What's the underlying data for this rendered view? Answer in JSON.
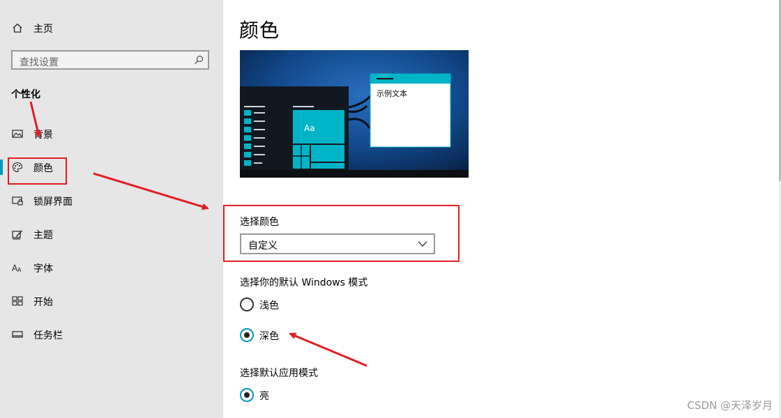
{
  "sidebar": {
    "home_label": "主页",
    "search_placeholder": "查找设置",
    "group_title": "个性化",
    "items": [
      {
        "label": "背景",
        "icon": "picture-icon"
      },
      {
        "label": "颜色",
        "icon": "palette-icon",
        "selected": true
      },
      {
        "label": "锁屏界面",
        "icon": "lock-screen-icon"
      },
      {
        "label": "主题",
        "icon": "theme-icon"
      },
      {
        "label": "字体",
        "icon": "font-icon"
      },
      {
        "label": "开始",
        "icon": "start-icon"
      },
      {
        "label": "任务栏",
        "icon": "taskbar-icon"
      }
    ],
    "accent_color": "#0099bc"
  },
  "main": {
    "title": "颜色",
    "preview": {
      "tile_text": "Aa",
      "window_text": "示例文本",
      "accent_color": "#00b4c8"
    },
    "choose_color": {
      "label": "选择颜色",
      "value": "自定义"
    },
    "windows_mode": {
      "label": "选择你的默认 Windows 模式",
      "options": [
        {
          "label": "浅色",
          "selected": false
        },
        {
          "label": "深色",
          "selected": true
        }
      ]
    },
    "app_mode": {
      "label": "选择默认应用模式",
      "options": [
        {
          "label": "亮",
          "selected": true
        }
      ]
    }
  },
  "annotation_color": "#e51c23",
  "watermark": "CSDN @天泽岁月"
}
